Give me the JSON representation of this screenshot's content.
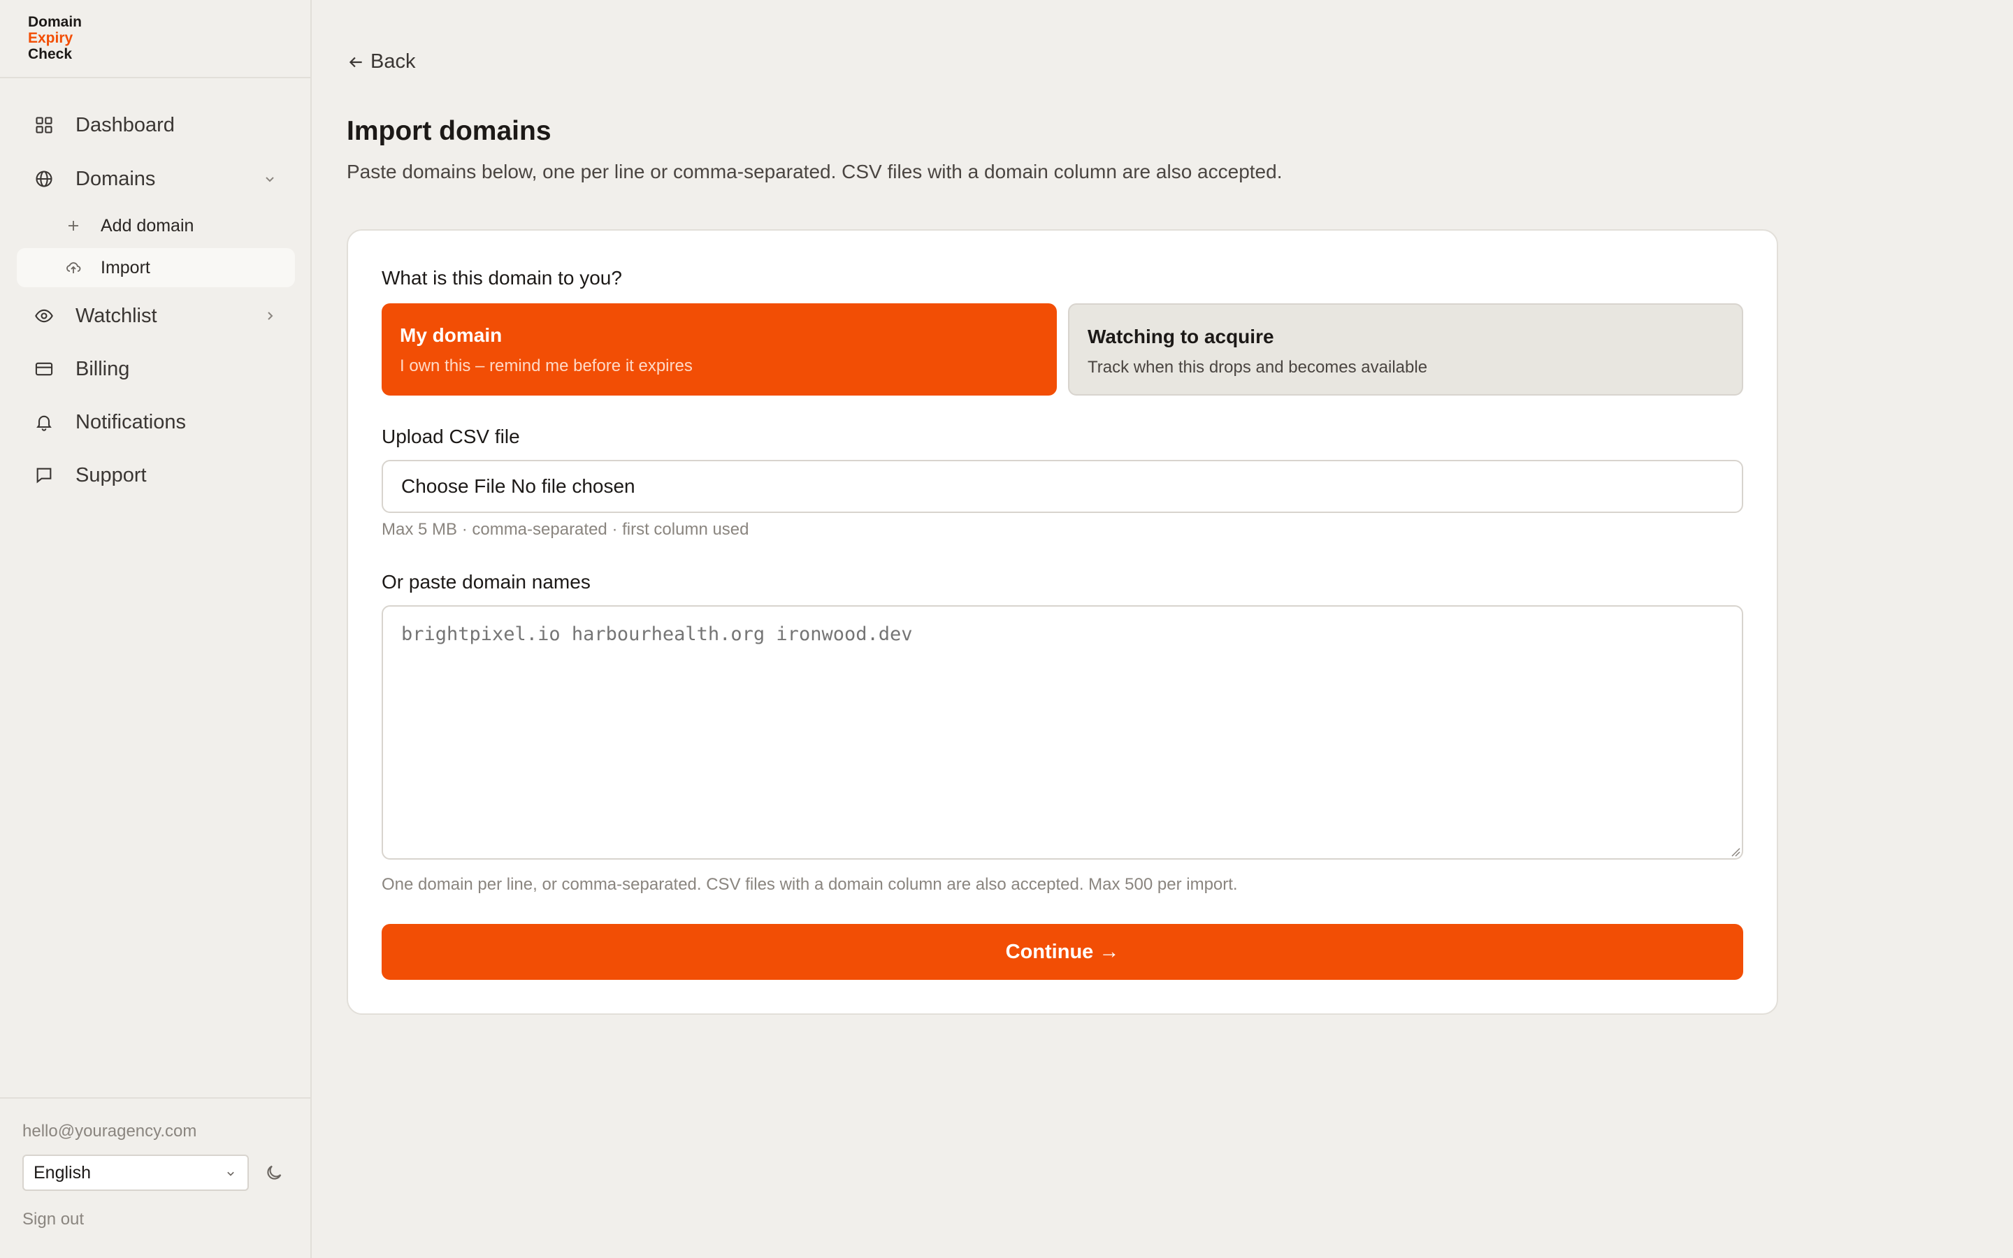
{
  "app": {
    "logo_line1": "Domain",
    "logo_line2": "Expiry",
    "logo_line3": "Check",
    "accent_color": "#f24e05"
  },
  "sidebar": {
    "items": [
      {
        "label": "Dashboard",
        "icon": "grid-icon"
      },
      {
        "label": "Domains",
        "icon": "globe-icon",
        "expanded": true
      },
      {
        "label": "Watchlist",
        "icon": "eye-icon",
        "expanded": false
      },
      {
        "label": "Billing",
        "icon": "credit-card-icon"
      },
      {
        "label": "Notifications",
        "icon": "bell-icon"
      },
      {
        "label": "Support",
        "icon": "chat-icon"
      }
    ],
    "sub_items": [
      {
        "label": "Add domain",
        "icon": "plus-icon"
      },
      {
        "label": "Import",
        "icon": "upload-cloud-icon",
        "active": true
      }
    ],
    "user_email": "hello@youragency.com",
    "language": "English",
    "sign_out": "Sign out"
  },
  "main": {
    "back_label": "Back",
    "title": "Import domains",
    "description": "Paste domains below, one per line or comma-separated. CSV files with a domain column are also accepted.",
    "question": "What is this domain to you?",
    "options": [
      {
        "title": "My domain",
        "subtitle": "I own this – remind me before it expires",
        "selected": true
      },
      {
        "title": "Watching to acquire",
        "subtitle": "Track when this drops and becomes available",
        "selected": false
      }
    ],
    "upload_label": "Upload CSV file",
    "file_input_text": "Choose File No file chosen",
    "upload_hint": "Max 5 MB · comma-separated · first column used",
    "paste_label": "Or paste domain names",
    "paste_placeholder": "brightpixel.io harbourhealth.org ironwood.dev",
    "paste_hint": "One domain per line, or comma-separated. CSV files with a domain column are also accepted. Max 500 per import.",
    "continue_label": "Continue →"
  }
}
